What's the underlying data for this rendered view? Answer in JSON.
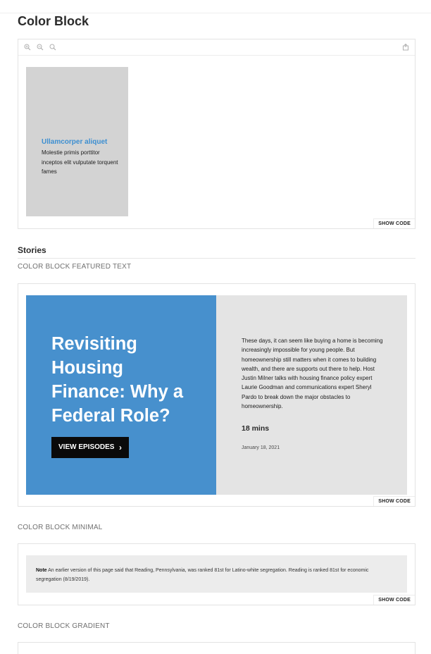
{
  "page": {
    "title": "Color Block"
  },
  "toolbar": {
    "icons": [
      "zoom-in-icon",
      "zoom-out-icon",
      "zoom-reset-icon",
      "open-new-tab-icon"
    ]
  },
  "color_block": {
    "card_title": "Ullamcorper aliquet",
    "card_text": "Molestie primis porttitor inceptos elit vulputate torquent fames",
    "show_code": "SHOW CODE"
  },
  "stories": {
    "title": "Stories"
  },
  "featured": {
    "label": "COLOR BLOCK FEATURED TEXT",
    "headline": "Revisiting Housing Finance: Why a Federal Role?",
    "button_label": "VIEW EPISODES",
    "description": "These days, it can seem like buying a home is becoming increasingly impossible for young people. But homeownership still matters when it comes to building wealth, and there are supports out there to help. Host Justin Milner talks with housing finance policy expert Laurie Goodman and communications expert Sheryl Pardo to break down the major obstacles to homeownership.",
    "duration": "18 mins",
    "date": "January 18, 2021",
    "show_code": "SHOW CODE"
  },
  "minimal": {
    "label": "COLOR BLOCK MINIMAL",
    "note_label": "Note",
    "note_text": "An earlier version of this page said that Reading, Pennsylvania, was ranked 81st for Latino-white segregation. Reading is ranked 81st for economic segregation (8/19/2019).",
    "show_code": "SHOW CODE"
  },
  "gradient": {
    "label": "COLOR BLOCK GRADIENT"
  },
  "colors": {
    "accent_blue": "#4790cd",
    "link_blue": "#3d8fd1",
    "card_grey": "#d3d3d3",
    "panel_grey": "#e4e4e4",
    "note_grey": "#ececec",
    "button_black": "#0a0a0a"
  }
}
